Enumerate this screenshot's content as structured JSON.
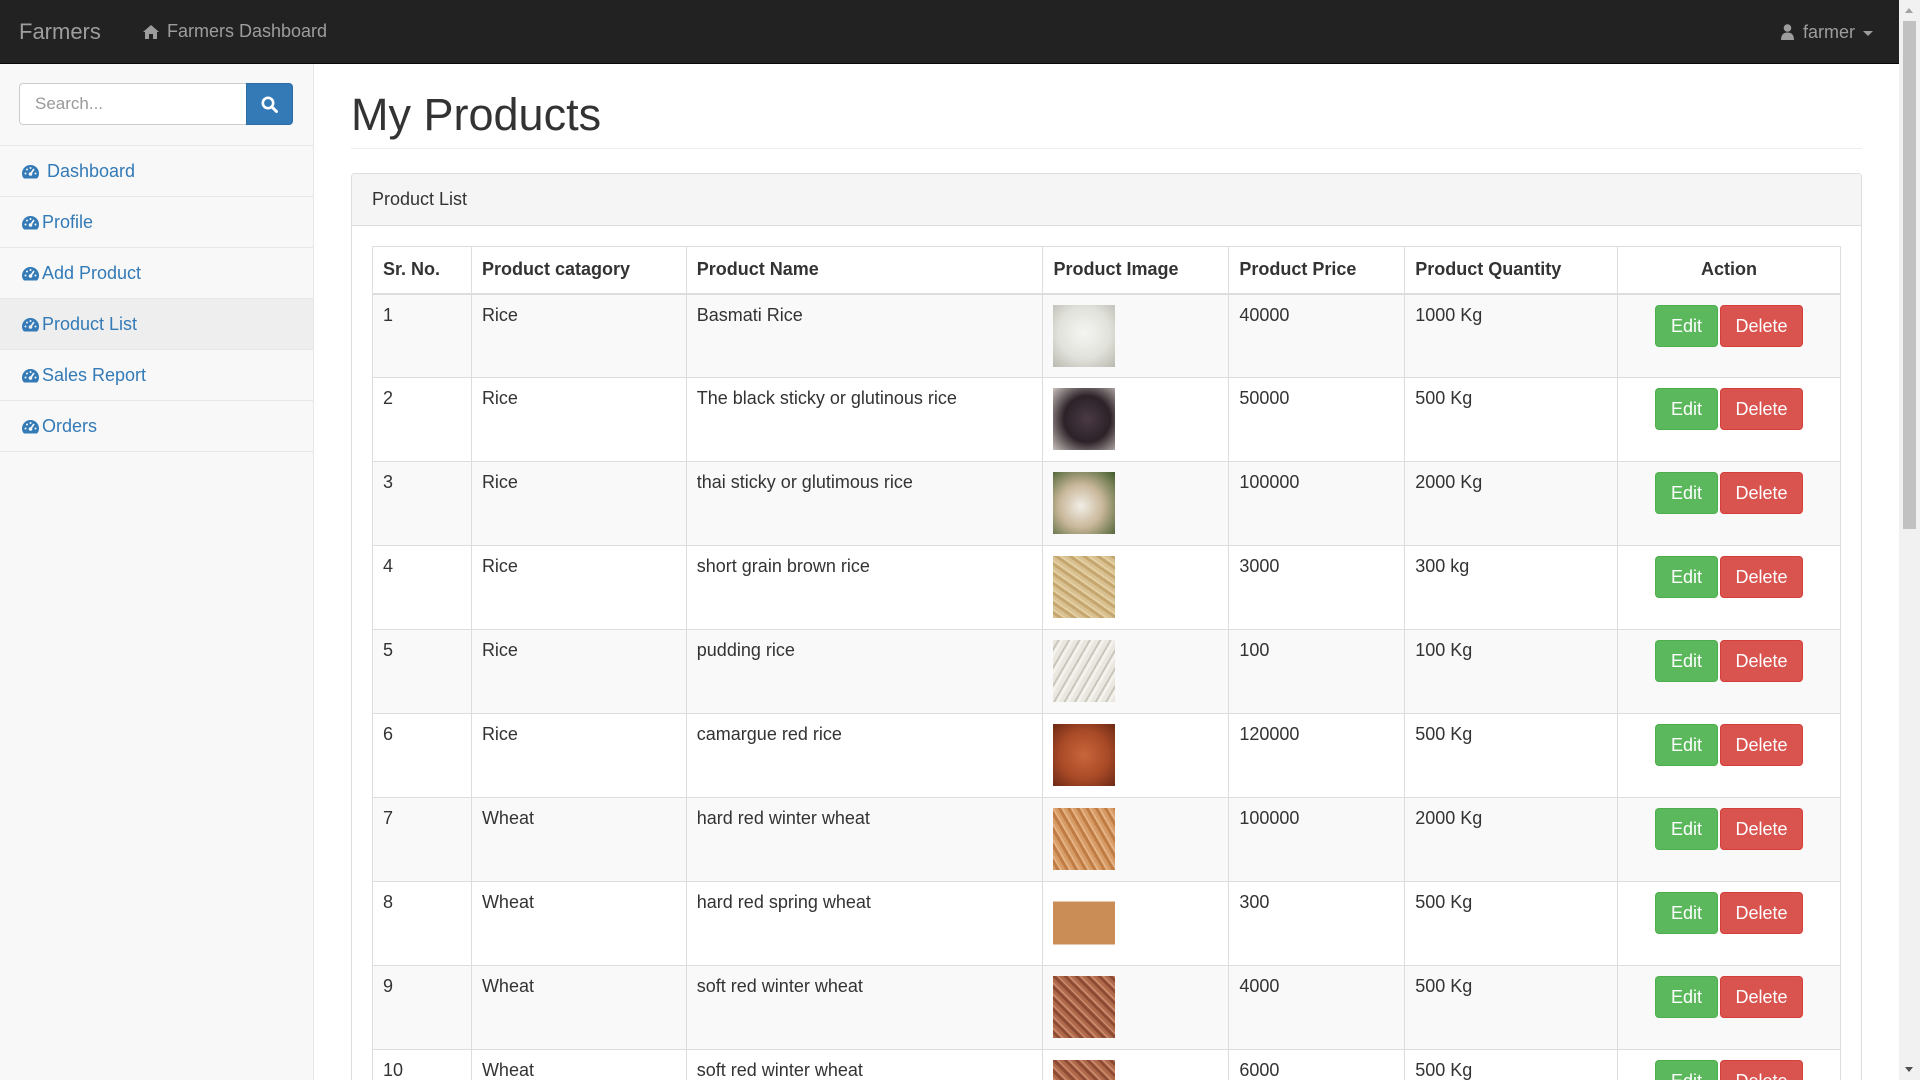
{
  "navbar": {
    "brand": "Farmers",
    "home_link": "Farmers Dashboard",
    "user": "farmer",
    "icons": {
      "home": "home-icon",
      "user": "user-icon"
    }
  },
  "sidebar": {
    "search_placeholder": "Search...",
    "items": [
      {
        "label": "Dashboard",
        "active": false
      },
      {
        "label": "Profile",
        "active": false
      },
      {
        "label": "Add Product",
        "active": false
      },
      {
        "label": "Product List",
        "active": true
      },
      {
        "label": "Sales Report",
        "active": false
      },
      {
        "label": "Orders",
        "active": false
      }
    ]
  },
  "main": {
    "title": "My Products",
    "panel_heading": "Product List",
    "table": {
      "headers": [
        "Sr. No.",
        "Product catagory",
        "Product Name",
        "Product Image",
        "Product Price",
        "Product Quantity",
        "Action"
      ],
      "rows": [
        {
          "sr": "1",
          "category": "Rice",
          "name": "Basmati Rice",
          "price": "40000",
          "quantity": "1000 Kg",
          "image": "basmati-rice-image"
        },
        {
          "sr": "2",
          "category": "Rice",
          "name": "The black sticky or glutinous rice",
          "price": "50000",
          "quantity": "500 Kg",
          "image": "black-sticky-rice-image"
        },
        {
          "sr": "3",
          "category": "Rice",
          "name": "thai sticky or glutimous rice",
          "price": "100000",
          "quantity": "2000 Kg",
          "image": "thai-sticky-rice-image"
        },
        {
          "sr": "4",
          "category": "Rice",
          "name": "short grain brown rice",
          "price": "3000",
          "quantity": "300 kg",
          "image": "brown-rice-image"
        },
        {
          "sr": "5",
          "category": "Rice",
          "name": "pudding rice",
          "price": "100",
          "quantity": "100 Kg",
          "image": "pudding-rice-image"
        },
        {
          "sr": "6",
          "category": "Rice",
          "name": "camargue red rice",
          "price": "120000",
          "quantity": "500 Kg",
          "image": "red-rice-image"
        },
        {
          "sr": "7",
          "category": "Wheat",
          "name": "hard red winter wheat",
          "price": "100000",
          "quantity": "2000 Kg",
          "image": "hard-red-winter-wheat-image"
        },
        {
          "sr": "8",
          "category": "Wheat",
          "name": "hard red spring wheat",
          "price": "300",
          "quantity": "500 Kg",
          "image": "hard-red-spring-wheat-image"
        },
        {
          "sr": "9",
          "category": "Wheat",
          "name": "soft red winter wheat",
          "price": "4000",
          "quantity": "500 Kg",
          "image": "soft-red-winter-wheat-image"
        },
        {
          "sr": "10",
          "category": "Wheat",
          "name": "soft red winter wheat",
          "price": "6000",
          "quantity": "500 Kg",
          "image": "soft-red-winter-wheat-image"
        }
      ],
      "edit_label": "Edit",
      "delete_label": "Delete"
    }
  },
  "colors": {
    "navbar_bg": "#222222",
    "link": "#337ab7",
    "edit_button": "#5cb85c",
    "delete_button": "#d9534f"
  }
}
